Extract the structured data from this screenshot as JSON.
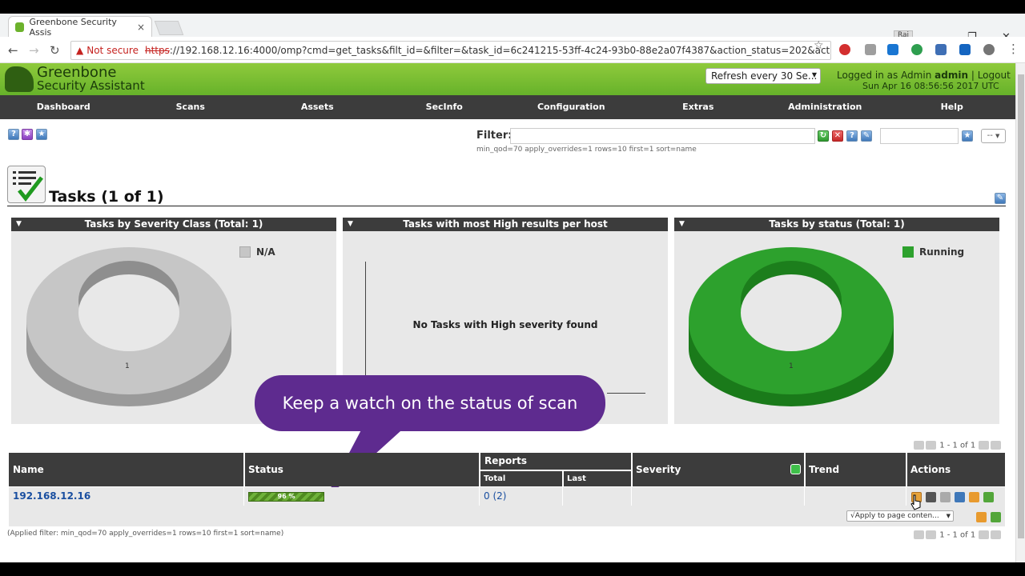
{
  "browser": {
    "tab_title": "Greenbone Security Assis",
    "tab_close": "×",
    "profile": "Raj",
    "win_min": "—",
    "win_restore": "❐",
    "win_close": "✕",
    "not_secure": "Not secure",
    "url_scheme": "https",
    "url_rest": "://192.168.12.16:4000/omp?cmd=get_tasks&filt_id=&filter=&task_id=6c241215-53ff-4c24-93b0-88e2a07f4387&action_status=202&acti"
  },
  "header": {
    "logo_line1": "Greenbone",
    "logo_line2": "Security Assistant",
    "refresh_select": "Refresh every 30 Se...",
    "logged_in_prefix": "Logged in as",
    "role": "Admin",
    "user": "admin",
    "separator": "|",
    "logout": "Logout",
    "datetime": "Sun Apr 16 08:56:56 2017 UTC"
  },
  "menu": [
    "Dashboard",
    "Scans",
    "Assets",
    "SecInfo",
    "Configuration",
    "Extras",
    "Administration",
    "Help"
  ],
  "filter": {
    "label": "Filter:",
    "value": "",
    "applied": "min_qod=70 apply_overrides=1 rows=10 first=1 sort=name",
    "select": "--"
  },
  "page": {
    "title": "Tasks (1 of 1)"
  },
  "charts": {
    "severity": {
      "title": "Tasks by Severity Class (Total: 1)",
      "legend": "N/A",
      "label": "1",
      "color": "#c6c6c6"
    },
    "high": {
      "title": "Tasks with most High results per host",
      "empty": "No Tasks with High severity found"
    },
    "status": {
      "title": "Tasks by status (Total: 1)",
      "legend": "Running",
      "label": "1",
      "color": "#2da12d"
    }
  },
  "callout": "Keep a watch on the status of scan",
  "pager": {
    "text": "1 - 1 of 1"
  },
  "table": {
    "headers": {
      "name": "Name",
      "status": "Status",
      "reports": "Reports",
      "total": "Total",
      "last": "Last",
      "severity": "Severity",
      "trend": "Trend",
      "actions": "Actions"
    },
    "rows": [
      {
        "name": "192.168.12.16",
        "status": "96 %",
        "progress": 0.96,
        "reports_total": "0",
        "reports_count": "(2)",
        "last": "",
        "severity": "",
        "trend": ""
      }
    ],
    "apply_select": "√Apply to page conten...",
    "applied_filter": "(Applied filter: min_qod=70 apply_overrides=1 rows=10 first=1 sort=name)"
  }
}
